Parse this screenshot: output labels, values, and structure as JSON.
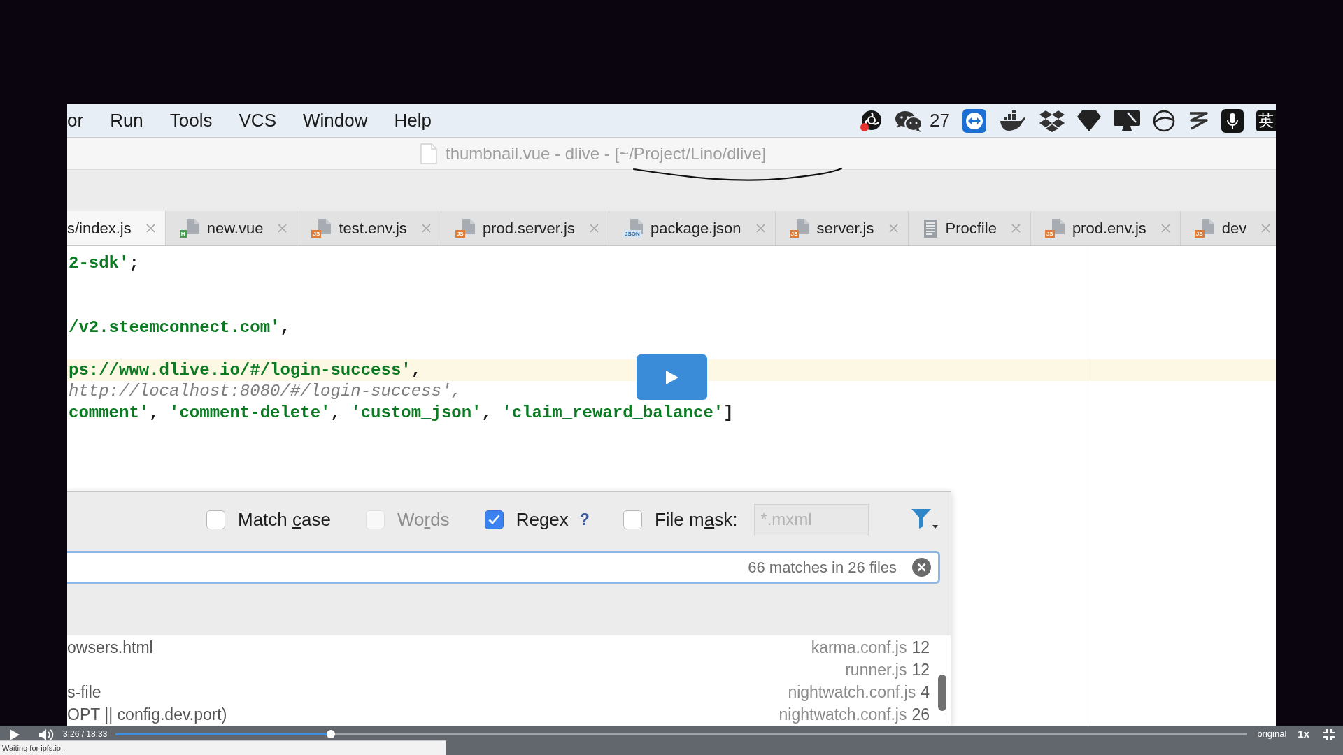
{
  "menu_bar": {
    "menus": [
      "or",
      "Run",
      "Tools",
      "VCS",
      "Window",
      "Help"
    ],
    "tray_count": "27",
    "input_method": "英"
  },
  "title_bar": {
    "title": "thumbnail.vue - dlive - [~/Project/Lino/dlive]"
  },
  "tabs": [
    {
      "label": "s/index.js",
      "selected": true
    },
    {
      "label": "new.vue",
      "selected": false,
      "kind": "vue",
      "badge": "H"
    },
    {
      "label": "test.env.js",
      "selected": false,
      "kind": "js",
      "badge": "JS"
    },
    {
      "label": "prod.server.js",
      "selected": false,
      "kind": "js",
      "badge": "JS"
    },
    {
      "label": "package.json",
      "selected": false,
      "kind": "json",
      "badge": "JSON"
    },
    {
      "label": "server.js",
      "selected": false,
      "kind": "js",
      "badge": "JS"
    },
    {
      "label": "Procfile",
      "selected": false,
      "kind": "text"
    },
    {
      "label": "prod.env.js",
      "selected": false,
      "kind": "js",
      "badge": "JS"
    },
    {
      "label": "dev",
      "selected": false,
      "kind": "js",
      "badge": "JS"
    }
  ],
  "editor": {
    "lines": [
      {
        "current": false,
        "tokens": [
          {
            "kind": "string",
            "text": "2-sdk'"
          },
          {
            "kind": "punct",
            "text": ";"
          }
        ]
      },
      {
        "current": false
      },
      {
        "current": false
      },
      {
        "current": false,
        "tokens": [
          {
            "kind": "string",
            "text": "/v2.steemconnect.com'"
          },
          {
            "kind": "punct",
            "text": ","
          }
        ]
      },
      {
        "current": false
      },
      {
        "current": true,
        "tokens": [
          {
            "kind": "string",
            "text": "ps://www.dlive.io/#/login-success'"
          },
          {
            "kind": "punct",
            "text": ","
          }
        ]
      },
      {
        "current": false,
        "tokens": [
          {
            "kind": "comment",
            "text": "http://localhost:8080/#/login-success',"
          }
        ]
      },
      {
        "current": false,
        "tokens": [
          {
            "kind": "string",
            "text": "comment'"
          },
          {
            "kind": "punct",
            "text": ", "
          },
          {
            "kind": "string",
            "text": "'comment-delete'"
          },
          {
            "kind": "punct",
            "text": ", "
          },
          {
            "kind": "string",
            "text": "'custom_json'"
          },
          {
            "kind": "punct",
            "text": ", "
          },
          {
            "kind": "string",
            "text": "'claim_reward_balance'"
          },
          {
            "kind": "punct",
            "text": "]"
          }
        ]
      }
    ]
  },
  "find_panel": {
    "options": [
      {
        "label_parts": [
          "Match ",
          "c",
          "ase"
        ],
        "checked": false,
        "disabled": false
      },
      {
        "label_parts": [
          "Wo",
          "r",
          "ds"
        ],
        "checked": false,
        "disabled": true
      },
      {
        "label_parts": [
          "Re",
          "g",
          "ex"
        ],
        "checked": true,
        "disabled": false,
        "help": "?"
      },
      {
        "label_parts": [
          "File m",
          "a",
          "sk:"
        ],
        "checked": false,
        "disabled": false
      }
    ],
    "file_mask": {
      "placeholder": "*.mxml",
      "disabled": true
    },
    "search": {
      "match_count": "66 matches in 26 files"
    },
    "results": [
      {
        "snippet": "owsers.html",
        "file": "karma.conf.js",
        "line": "12"
      },
      {
        "file": "runner.js",
        "line": "12"
      },
      {
        "snippet": "s-file",
        "file": "nightwatch.conf.js",
        "line": "4"
      },
      {
        "snippet": "OPT || config.dev.port)",
        "file": "nightwatch.conf.js",
        "line": "26"
      }
    ]
  },
  "video_controls": {
    "time": "3:26 / 18:33",
    "progress": {
      "level": 0.19
    },
    "quality": "original",
    "speed": "1x"
  },
  "status_bubble": "Waiting for ipfs.io..."
}
